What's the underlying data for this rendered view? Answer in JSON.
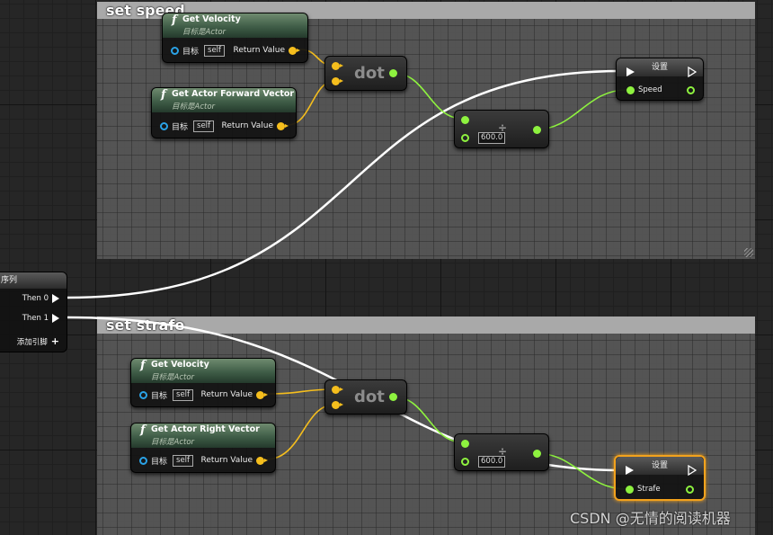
{
  "comments": {
    "set_speed": {
      "title": "set speed"
    },
    "set_strafe": {
      "title": "set strafe"
    }
  },
  "sequence": {
    "title": "序列",
    "then0": "Then 0",
    "then1": "Then 1",
    "add_pin": "添加引脚"
  },
  "speed_group": {
    "get_velocity": {
      "title": "Get Velocity",
      "subtitle": "目标是Actor",
      "target_label": "目标",
      "target_value": "self",
      "return_label": "Return Value"
    },
    "get_forward": {
      "title": "Get Actor Forward Vector",
      "subtitle": "目标是Actor",
      "target_label": "目标",
      "target_value": "self",
      "return_label": "Return Value"
    },
    "dot": {
      "label": "dot"
    },
    "divide": {
      "glyph": "÷",
      "value": "600.0"
    },
    "set": {
      "title": "设置",
      "var_name": "Speed"
    }
  },
  "strafe_group": {
    "get_velocity": {
      "title": "Get Velocity",
      "subtitle": "目标是Actor",
      "target_label": "目标",
      "target_value": "self",
      "return_label": "Return Value"
    },
    "get_right": {
      "title": "Get Actor Right Vector",
      "subtitle": "目标是Actor",
      "target_label": "目标",
      "target_value": "self",
      "return_label": "Return Value"
    },
    "dot": {
      "label": "dot"
    },
    "divide": {
      "glyph": "÷",
      "value": "600.0"
    },
    "set": {
      "title": "设置",
      "var_name": "Strafe"
    }
  },
  "watermark": "CSDN @无情的阅读机器",
  "colors": {
    "exec_wire": "#ffffff",
    "vector_wire": "#f5be1d",
    "float_wire": "#8ef23f",
    "object_pin": "#2aa2e6",
    "selected_outline": "#f3a21c"
  }
}
